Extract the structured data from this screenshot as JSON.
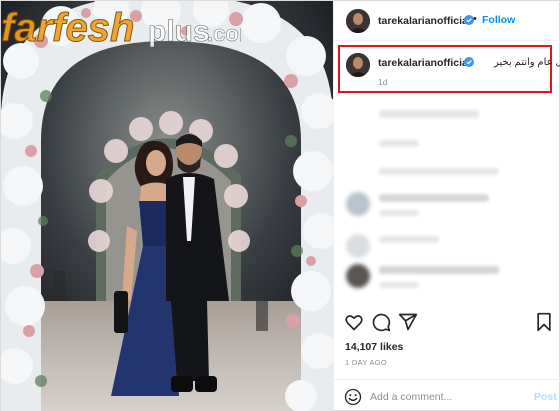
{
  "header": {
    "username": "tarekalarianofficial",
    "separator": "•",
    "follow_label": "Follow",
    "icons": [
      "avatar",
      "verified-badge-icon"
    ]
  },
  "caption": {
    "username": "tarekalarianofficial",
    "text": "كل عام وانتم بخير",
    "time": "1d",
    "highlight_color": "#e0141b"
  },
  "watermark": {
    "brand_a": "farfesh",
    "brand_b": "plus",
    "suffix": ".com"
  },
  "actions": {
    "icons": [
      "heart-icon",
      "comment-icon",
      "share-icon",
      "bookmark-icon"
    ]
  },
  "likes": "14,107 likes",
  "date": "1 DAY AGO",
  "add_comment": {
    "placeholder": "Add a comment...",
    "post_label": "Post",
    "emoji_icon": "smiley-icon"
  },
  "colors": {
    "link_blue": "#0095f6",
    "post_disabled": "#b3dbff",
    "secondary_text": "#8e8e8e",
    "verified": "#3897f0"
  }
}
